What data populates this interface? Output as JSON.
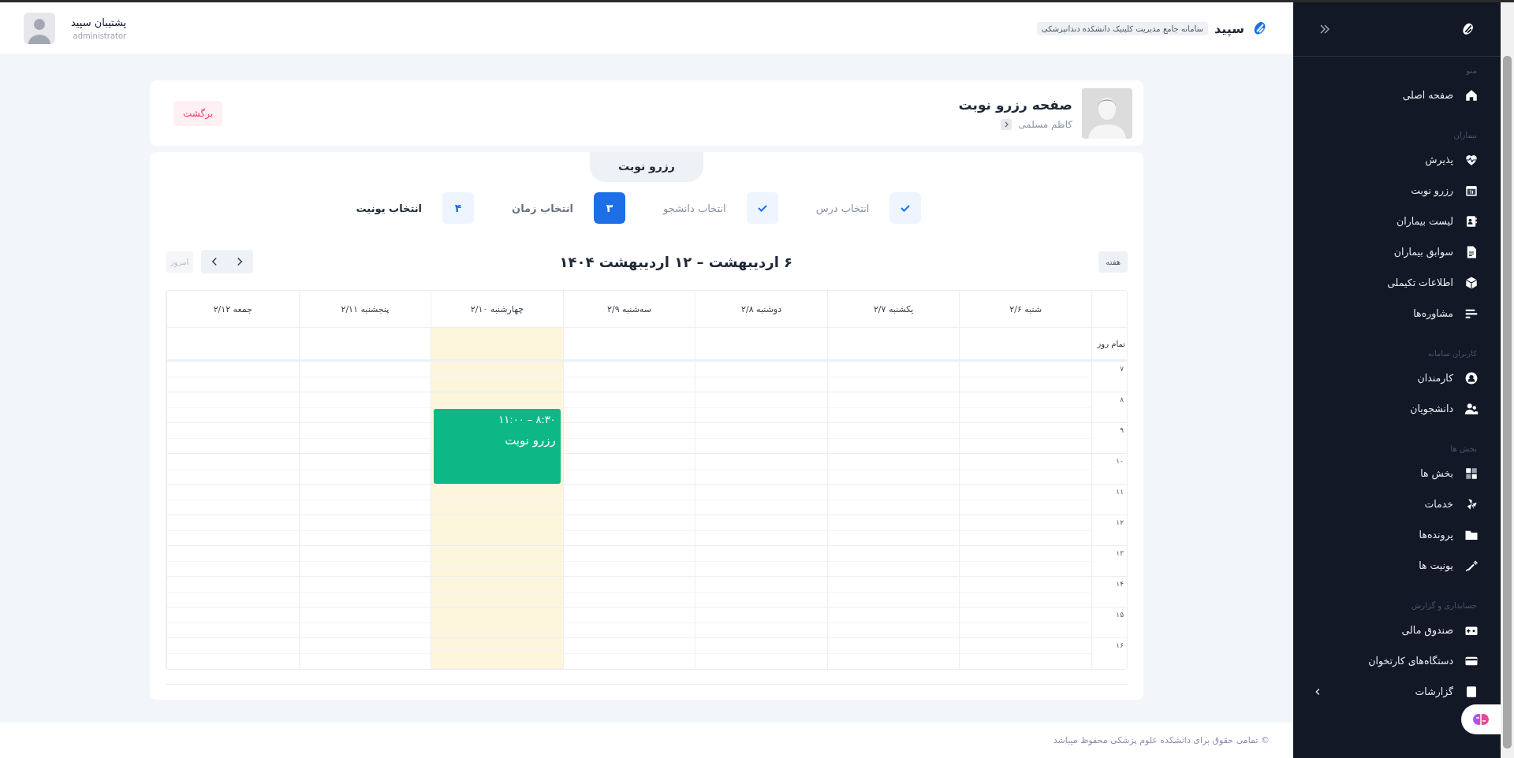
{
  "header": {
    "brand": "سپید",
    "tagline": "سامانه جامع مدیریت کلینیک دانشکده دندانپزشکی",
    "user_name": "پشتیبان سپید",
    "user_role": "administrator"
  },
  "page_header": {
    "title": "صفحه رزرو نوبت",
    "breadcrumb": "کاظم مسلمی",
    "back_button": "برگشت"
  },
  "tab": "رزرو نوبت",
  "steps": [
    {
      "label": "انتخاب درس",
      "kind": "done"
    },
    {
      "label": "انتخاب دانشجو",
      "kind": "done"
    },
    {
      "label": "انتخاب زمان",
      "kind": "current",
      "number": "۳"
    },
    {
      "label": "انتخاب یونیت",
      "kind": "pending",
      "number": "۴"
    }
  ],
  "calendar": {
    "view_button": "هفته",
    "title": "۶ اردیبهشت – ۱۲ اردیبهشت ۱۴۰۴",
    "today_button": "امروز",
    "today_disabled": true,
    "all_day_label": "تمام روز",
    "hours": [
      "۷",
      "۸",
      "۹",
      "۱۰",
      "۱۱",
      "۱۲",
      "۱۳",
      "۱۴",
      "۱۵",
      "۱۶"
    ],
    "days": [
      {
        "label": "شنبه ۲/۶",
        "today": false
      },
      {
        "label": "یکشنبه ۲/۷",
        "today": false
      },
      {
        "label": "دوشنبه ۲/۸",
        "today": false
      },
      {
        "label": "سه‌شنبه ۲/۹",
        "today": false
      },
      {
        "label": "چهارشنبه ۲/۱۰",
        "today": true,
        "events": [
          {
            "time": "۸:۳۰ – ۱۱:۰۰",
            "title": "رزرو نوبت"
          }
        ]
      },
      {
        "label": "پنجشنبه ۲/۱۱",
        "today": false
      },
      {
        "label": "جمعه ۲/۱۲",
        "today": false
      }
    ]
  },
  "footer": "© تمامی حقوق برای دانشکده علوم پزشکی محفوظ میباشد",
  "sidebar": {
    "sections": [
      {
        "title": "منو",
        "items": [
          {
            "label": "صفحه اصلی",
            "expandable": false
          }
        ]
      },
      {
        "title": "بیماران",
        "items": [
          {
            "label": "پذیرش",
            "expandable": false
          },
          {
            "label": "رزرو نوبت",
            "expandable": false
          },
          {
            "label": "لیست بیماران",
            "expandable": false
          },
          {
            "label": "سوابق بیماران",
            "expandable": false
          },
          {
            "label": "اطلاعات تکیملی",
            "expandable": false
          },
          {
            "label": "مشاوره‌ها",
            "expandable": false
          }
        ]
      },
      {
        "title": "کاربران سامانه",
        "items": [
          {
            "label": "کارمندان",
            "expandable": false
          },
          {
            "label": "دانشجویان",
            "expandable": false
          }
        ]
      },
      {
        "title": "بخش ها",
        "items": [
          {
            "label": "بخش ها",
            "expandable": false
          },
          {
            "label": "خدمات",
            "expandable": false
          },
          {
            "label": "پرونده‌ها",
            "expandable": false
          },
          {
            "label": "یونیت ها",
            "expandable": false
          }
        ]
      },
      {
        "title": "حسابداری و گزارش",
        "items": [
          {
            "label": "صندوق مالی",
            "expandable": false
          },
          {
            "label": "دستگاه‌های کارتخوان",
            "expandable": false
          },
          {
            "label": "گزارشات",
            "expandable": true
          }
        ]
      }
    ]
  }
}
